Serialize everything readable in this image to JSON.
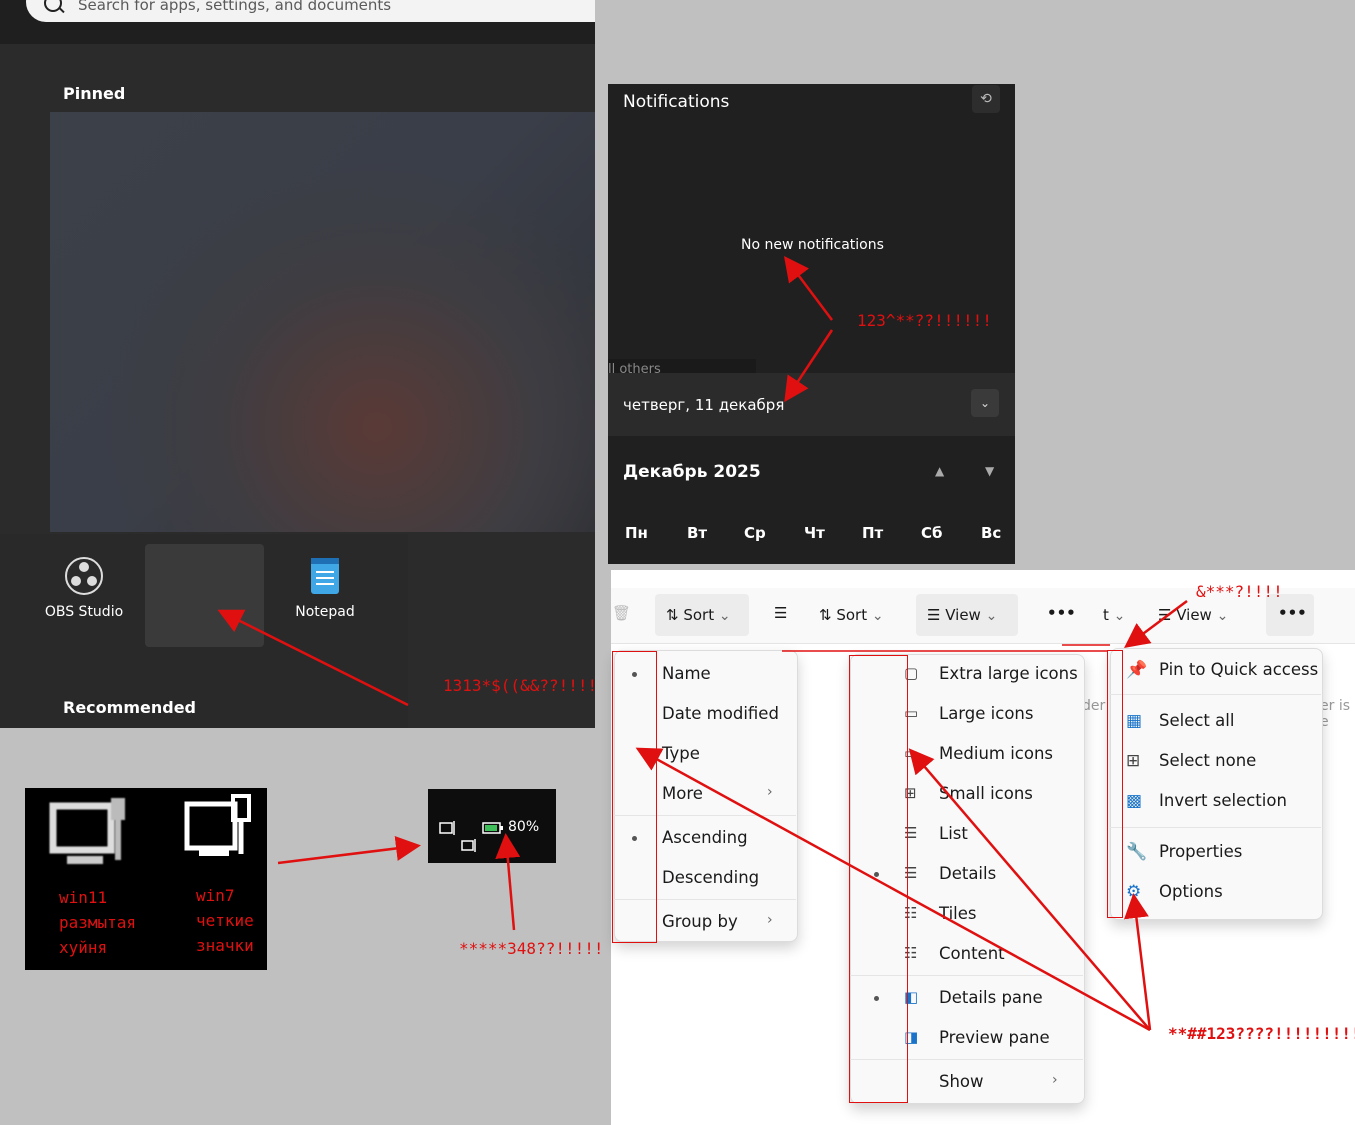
{
  "start_menu": {
    "search_placeholder": "Search for apps, settings, and documents",
    "pinned_label": "Pinned",
    "apps": [
      {
        "label": "OBS Studio",
        "icon": "obs-icon"
      },
      {
        "label": "",
        "icon": "empty-tile"
      },
      {
        "label": "Notepad",
        "icon": "notepad-icon"
      }
    ],
    "recommended_label": "Recommended"
  },
  "notifications": {
    "title": "Notifications",
    "empty_text": "No new notifications",
    "clear_others": "ll others",
    "date": "четверг, 11 декабря",
    "month": "Декабрь 2025",
    "weekdays": [
      "Пн",
      "Вт",
      "Ср",
      "Чт",
      "Пт",
      "Сб",
      "Вс"
    ]
  },
  "tray_compare": {
    "win11_label": [
      "win11",
      "размытая",
      "хуйня"
    ],
    "win7_label": [
      "win7",
      "четкие",
      "значки"
    ],
    "battery": "80%"
  },
  "explorer": {
    "toolbar": {
      "sort1": "Sort",
      "sort2": "Sort",
      "view1": "View",
      "t": "t",
      "view2": "View",
      "more": "•••"
    },
    "sort_menu": [
      {
        "label": "Name",
        "dot": true
      },
      {
        "label": "Date modified",
        "dot": false
      },
      {
        "label": "Type",
        "dot": false
      },
      {
        "label": "More",
        "dot": false,
        "sub": true
      },
      {
        "label": "Ascending",
        "dot": true
      },
      {
        "label": "Descending",
        "dot": false
      },
      {
        "label": "Group by",
        "dot": false,
        "sub": true
      }
    ],
    "view_menu": [
      {
        "label": "Extra large icons",
        "dot": false
      },
      {
        "label": "Large icons",
        "dot": false
      },
      {
        "label": "Medium icons",
        "dot": false
      },
      {
        "label": "Small icons",
        "dot": false
      },
      {
        "label": "List",
        "dot": false
      },
      {
        "label": "Details",
        "dot": true
      },
      {
        "label": "Tiles",
        "dot": false
      },
      {
        "label": "Content",
        "dot": false
      },
      {
        "label": "Details pane",
        "dot": true
      },
      {
        "label": "Preview pane",
        "dot": false
      },
      {
        "label": "Show",
        "dot": false,
        "sub": true
      }
    ],
    "more_menu": [
      {
        "label": "Pin to Quick access"
      },
      {
        "label": "Select all"
      },
      {
        "label": "Select none"
      },
      {
        "label": "Invert selection"
      },
      {
        "label": "Properties"
      },
      {
        "label": "Options"
      }
    ],
    "bg_fragments": [
      "der",
      "er is e"
    ]
  },
  "annotations": {
    "a1": "123^**??!!!!!!",
    "a2": "1313*$((&&??!!!!",
    "a3": "*****348??!!!!!",
    "a4": "&***?!!!!",
    "a5": "**##123????!!!!!!!!!!!!"
  },
  "colors": {
    "annotation": "#e01010",
    "dark_panel": "#202020"
  }
}
